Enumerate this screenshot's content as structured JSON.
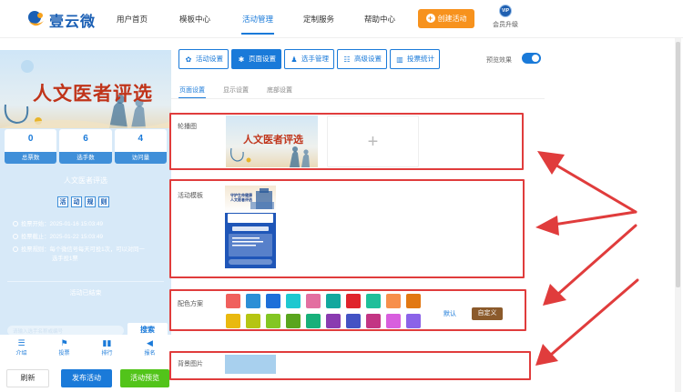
{
  "brand": {
    "name": "壹云微"
  },
  "nav": {
    "items": [
      "用户首页",
      "模板中心",
      "活动管理",
      "定制服务",
      "帮助中心"
    ],
    "create_label": "创建活动",
    "vip_badge": "VIP",
    "vip_label": "会员升级"
  },
  "preview": {
    "banner_title": "人文医者评选",
    "stats": [
      {
        "value": "0",
        "label": "总票数"
      },
      {
        "value": "6",
        "label": "选手数"
      },
      {
        "value": "4",
        "label": "访问量"
      }
    ],
    "event_name": "人文医者评选",
    "rules_chars": [
      "活",
      "动",
      "规",
      "则"
    ],
    "info": [
      "投票开始：2025-01-16 15:03:49",
      "投票截止：2025-01-22 15:03:49",
      "投票规则：每个微信号每天可投1次，可以对同一",
      "选手投1票"
    ],
    "closed_text": "活动已结束",
    "search_placeholder": "请输入选手名称或编号",
    "search_button": "搜索",
    "tabs": [
      {
        "icon": "list-icon",
        "label": "介绍"
      },
      {
        "icon": "flag-icon",
        "label": "投票"
      },
      {
        "icon": "bar-chart-icon",
        "label": "排行"
      },
      {
        "icon": "megaphone-icon",
        "label": "报名"
      }
    ]
  },
  "actions": {
    "refresh": "刷新",
    "publish": "发布活动",
    "preview": "活动预览"
  },
  "toolbar": {
    "buttons": [
      {
        "icon": "gear-icon",
        "label": "活动设置"
      },
      {
        "icon": "settings-icon",
        "label": "页面设置"
      },
      {
        "icon": "users-icon",
        "label": "选手管理"
      },
      {
        "icon": "sliders-icon",
        "label": "高级设置"
      },
      {
        "icon": "bar-chart-icon",
        "label": "投票统计"
      }
    ],
    "preview_toggle_label": "预览效果"
  },
  "subtabs": [
    "页面设置",
    "显示设置",
    "底部设置"
  ],
  "sections": {
    "carousel_label": "轮播图",
    "carousel_image_title": "人文医者评选",
    "template_label": "活动模板",
    "template_image_title": "守护生命健康 人文医者评选",
    "color_label": "配色方案",
    "color_default": "默认",
    "color_custom": "自定义",
    "background_label": "背景图片"
  },
  "color_swatches": [
    "#f0605d",
    "#2b8fd6",
    "#1e6fd9",
    "#1ec8d0",
    "#e36fa0",
    "#13a89e",
    "#e0242c",
    "#1fbf9a",
    "#f78f4b",
    "#e27812",
    "#e9b90f",
    "#b5c512",
    "#83c623",
    "#5aa51e",
    "#17b07a",
    "#8a3bb0",
    "#4453c4",
    "#c33584",
    "#d85fde",
    "#8b63e8"
  ],
  "colors": {
    "accent": "#1a7ad9",
    "highlight": "#e03c3c",
    "create": "#f7921d"
  }
}
